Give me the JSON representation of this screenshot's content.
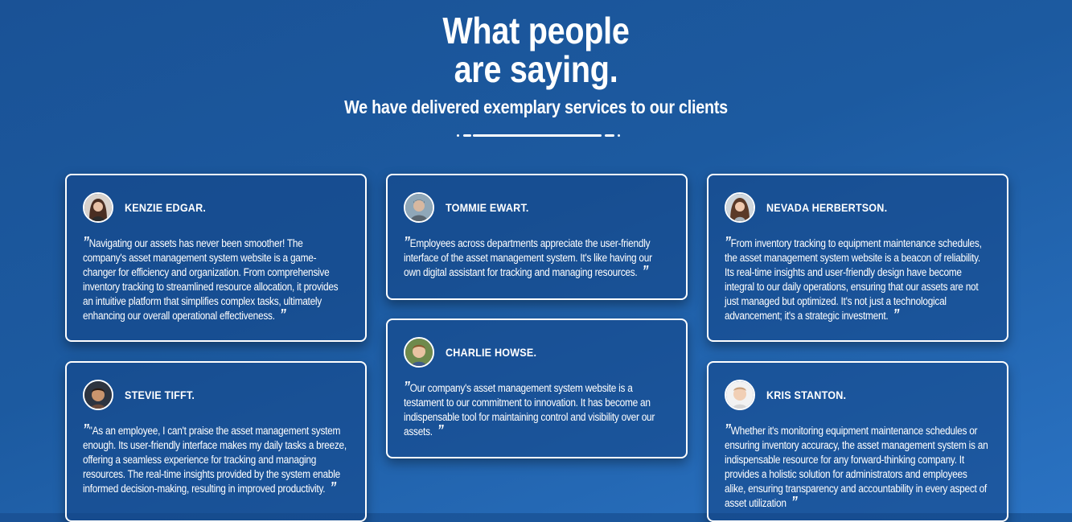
{
  "header": {
    "title_line1": "What people",
    "title_line2": "are saying.",
    "subtitle": "We have delivered exemplary services to our clients"
  },
  "testimonials": [
    {
      "name": "KENZIE EDGAR.",
      "avatar": "woman-portrait-avatar",
      "text": "Navigating our assets has never been smoother! The company's asset management system website is a game-changer for efficiency and organization. From comprehensive inventory tracking to streamlined resource allocation, it provides an intuitive platform that simplifies complex tasks, ultimately enhancing our overall operational effectiveness."
    },
    {
      "name": "TOMMIE EWART.",
      "avatar": "man-portrait-avatar",
      "text": "Employees across departments appreciate the user-friendly interface of the asset management system. It's like having our own digital assistant for tracking and managing resources."
    },
    {
      "name": "NEVADA HERBERTSON.",
      "avatar": "woman-portrait-avatar",
      "text": "From inventory tracking to equipment maintenance schedules, the asset management system website is a beacon of reliability. Its real-time insights and user-friendly design have become integral to our daily operations, ensuring that our assets are not just managed but optimized. It's not just a technological advancement; it's a strategic investment."
    },
    {
      "name": "STEVIE TIFFT.",
      "avatar": "child-portrait-avatar",
      "text": "\"As an employee, I can't praise the asset management system enough. Its user-friendly interface makes my daily tasks a breeze, offering a seamless experience for tracking and managing resources. The real-time insights provided by the system enable informed decision-making, resulting in improved productivity."
    },
    {
      "name": "CHARLIE HOWSE.",
      "avatar": "boy-portrait-avatar",
      "text": "Our company's asset management system website is a testament to our commitment to innovation. It has become an indispensable tool for maintaining control and visibility over our assets."
    },
    {
      "name": "KRIS STANTON.",
      "avatar": "man-portrait-avatar",
      "text": "Whether it's monitoring equipment maintenance schedules or ensuring inventory accuracy, the asset management system is an indispensable resource for any forward-thinking company. It provides a holistic solution for administrators and employees alike, ensuring transparency and accountability in every aspect of asset utilization"
    }
  ],
  "quote_open": "”",
  "quote_close": "”"
}
